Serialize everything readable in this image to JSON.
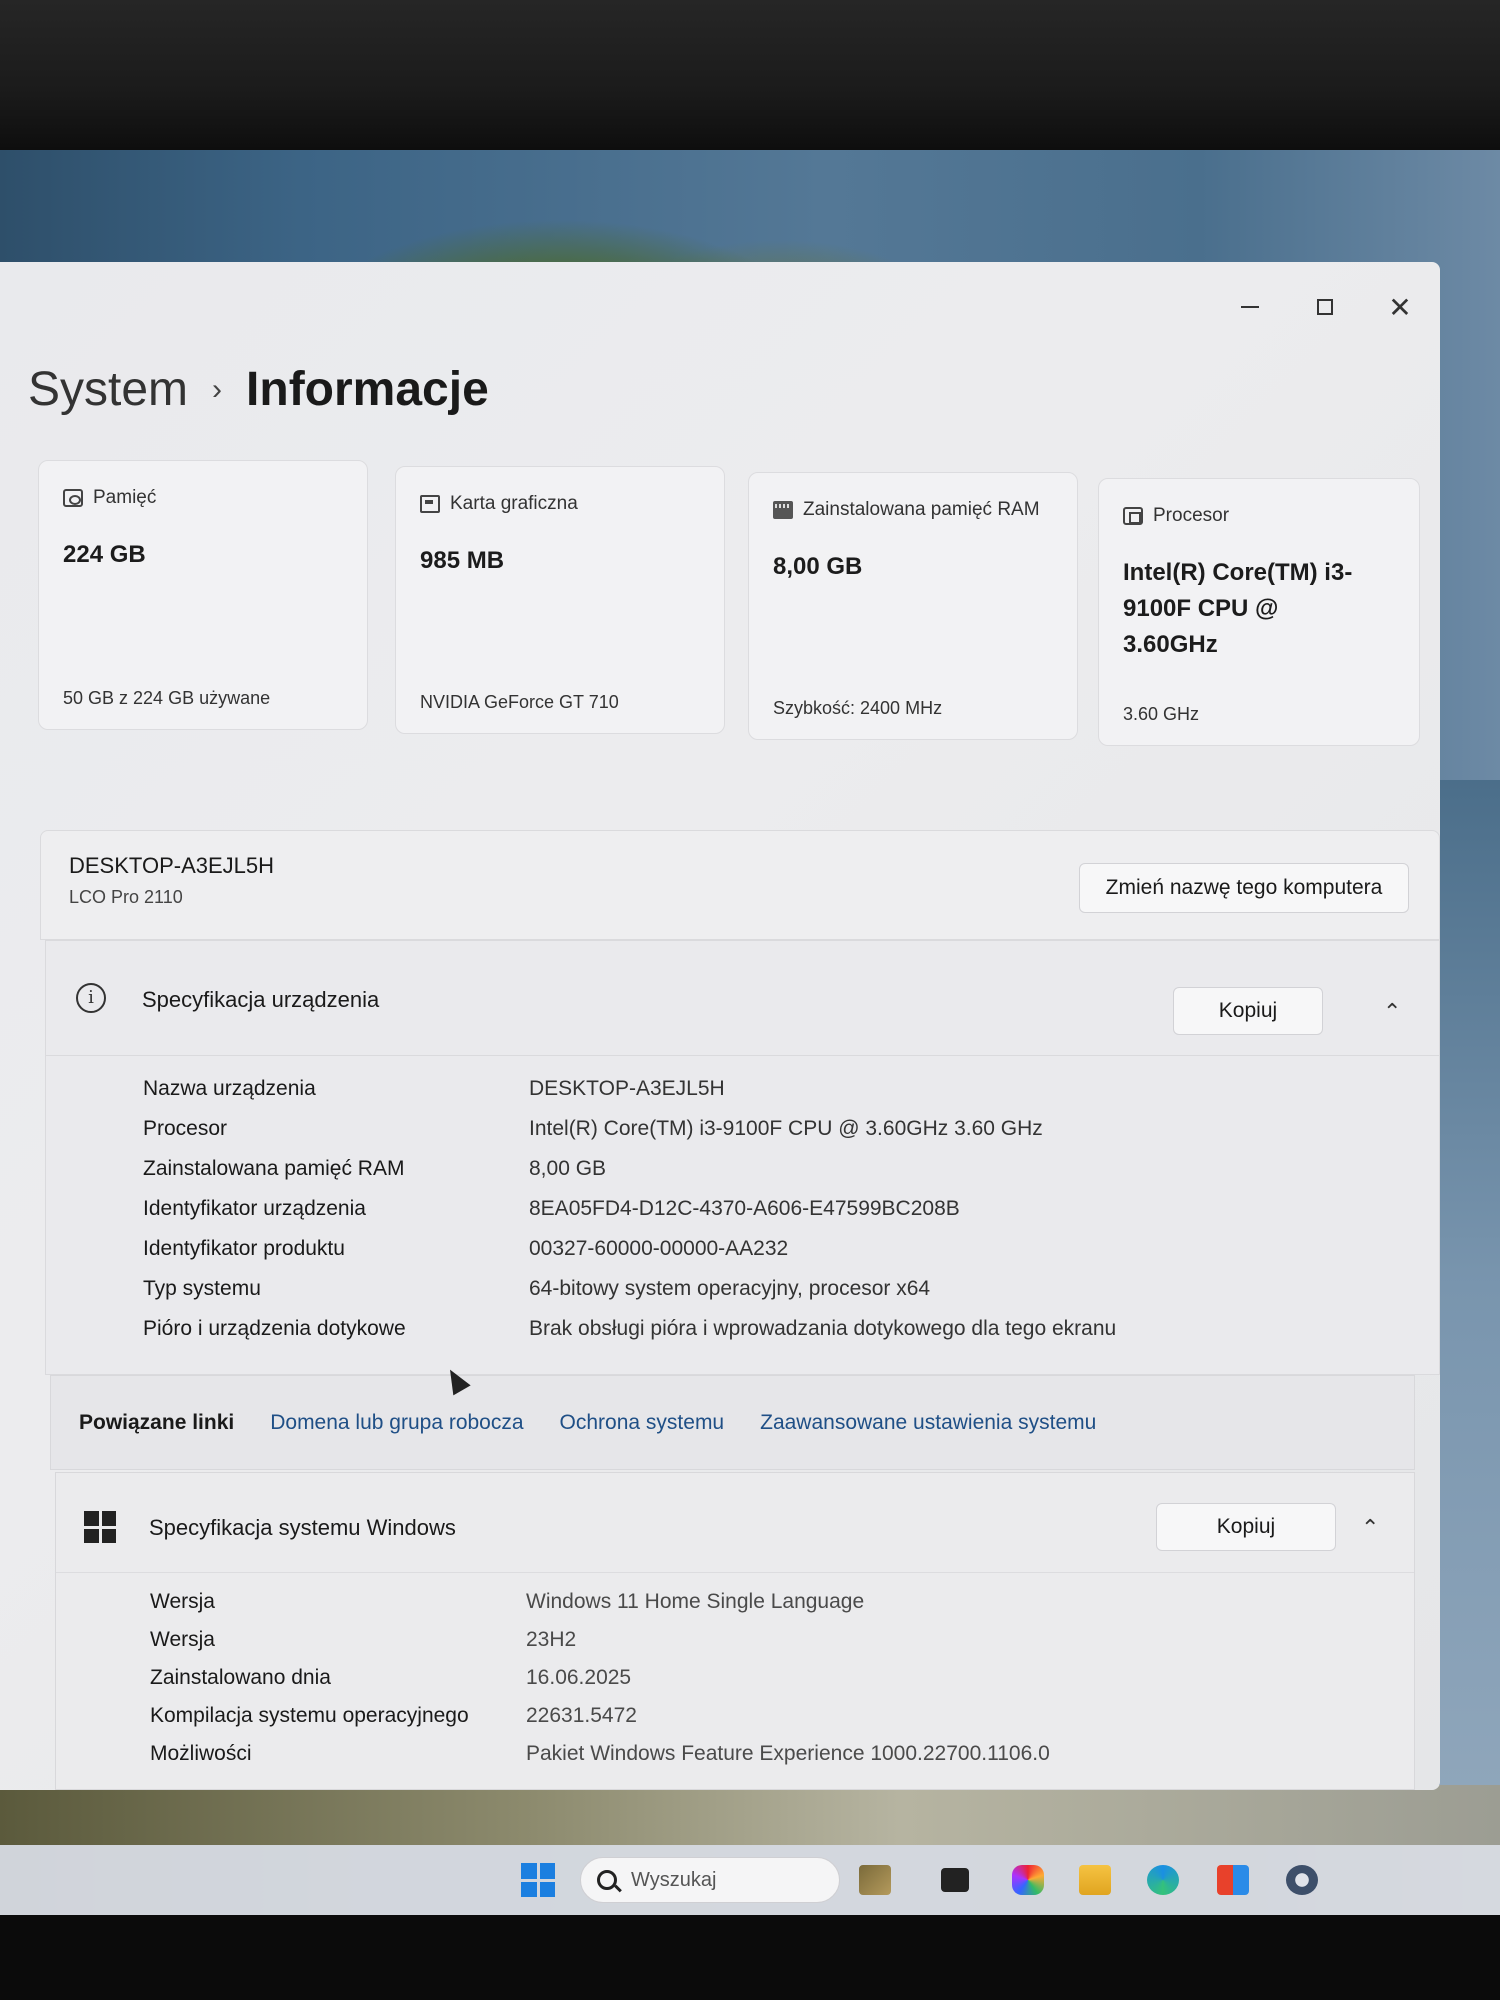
{
  "window": {
    "breadcrumb_root": "System",
    "breadcrumb_sep": "›",
    "page_title": "Informacje",
    "close_glyph": "✕"
  },
  "cards": [
    {
      "icon": "drive-icon",
      "label": "Pamięć",
      "value": "224 GB",
      "footer": "50 GB z 224 GB używane"
    },
    {
      "icon": "gpu-icon",
      "label": "Karta graficzna",
      "value": "985 MB",
      "footer": "NVIDIA GeForce GT 710"
    },
    {
      "icon": "ram-icon",
      "label": "Zainstalowana pamięć RAM",
      "value": "8,00 GB",
      "footer": "Szybkość: 2400 MHz"
    },
    {
      "icon": "cpu-icon",
      "label": "Procesor",
      "value": "Intel(R) Core(TM) i3-9100F CPU @ 3.60GHz",
      "footer": "3.60 GHz"
    }
  ],
  "device": {
    "name": "DESKTOP-A3EJL5H",
    "model": "LCO Pro 2110",
    "rename_label": "Zmień nazwę tego komputera"
  },
  "device_spec": {
    "title": "Specyfikacja urządzenia",
    "copy_label": "Kopiuj",
    "chevron": "⌃",
    "rows": [
      {
        "k": "Nazwa urządzenia",
        "v": "DESKTOP-A3EJL5H"
      },
      {
        "k": "Procesor",
        "v": "Intel(R) Core(TM) i3-9100F CPU @ 3.60GHz   3.60 GHz"
      },
      {
        "k": "Zainstalowana pamięć RAM",
        "v": "8,00 GB"
      },
      {
        "k": "Identyfikator urządzenia",
        "v": "8EA05FD4-D12C-4370-A606-E47599BC208B"
      },
      {
        "k": "Identyfikator produktu",
        "v": "00327-60000-00000-AA232"
      },
      {
        "k": "Typ systemu",
        "v": "64-bitowy system operacyjny, procesor x64"
      },
      {
        "k": "Pióro i urządzenia dotykowe",
        "v": "Brak obsługi pióra i wprowadzania dotykowego dla tego ekranu"
      }
    ]
  },
  "related_links": {
    "label": "Powiązane linki",
    "links": [
      "Domena lub grupa robocza",
      "Ochrona systemu",
      "Zaawansowane ustawienia systemu"
    ]
  },
  "windows_spec": {
    "title": "Specyfikacja systemu Windows",
    "copy_label": "Kopiuj",
    "chevron": "⌃",
    "rows": [
      {
        "k": "Wersja",
        "v": "Windows 11 Home Single Language"
      },
      {
        "k": "Wersja",
        "v": "23H2"
      },
      {
        "k": "Zainstalowano dnia",
        "v": "16.06.2025"
      },
      {
        "k": "Kompilacja systemu operacyjnego",
        "v": "22631.5472"
      },
      {
        "k": "Możliwości",
        "v": "Pakiet Windows Feature Experience 1000.22700.1106.0"
      }
    ]
  },
  "taskbar": {
    "search_placeholder": "Wyszukaj",
    "pinned": [
      "start-icon",
      "search-icon",
      "widgets-icon",
      "task-view-icon",
      "copilot-icon",
      "file-explorer-icon",
      "edge-icon",
      "store-icon",
      "settings-icon"
    ]
  },
  "colors": {
    "accent": "#1b7fe0",
    "link": "#1f4f86"
  }
}
